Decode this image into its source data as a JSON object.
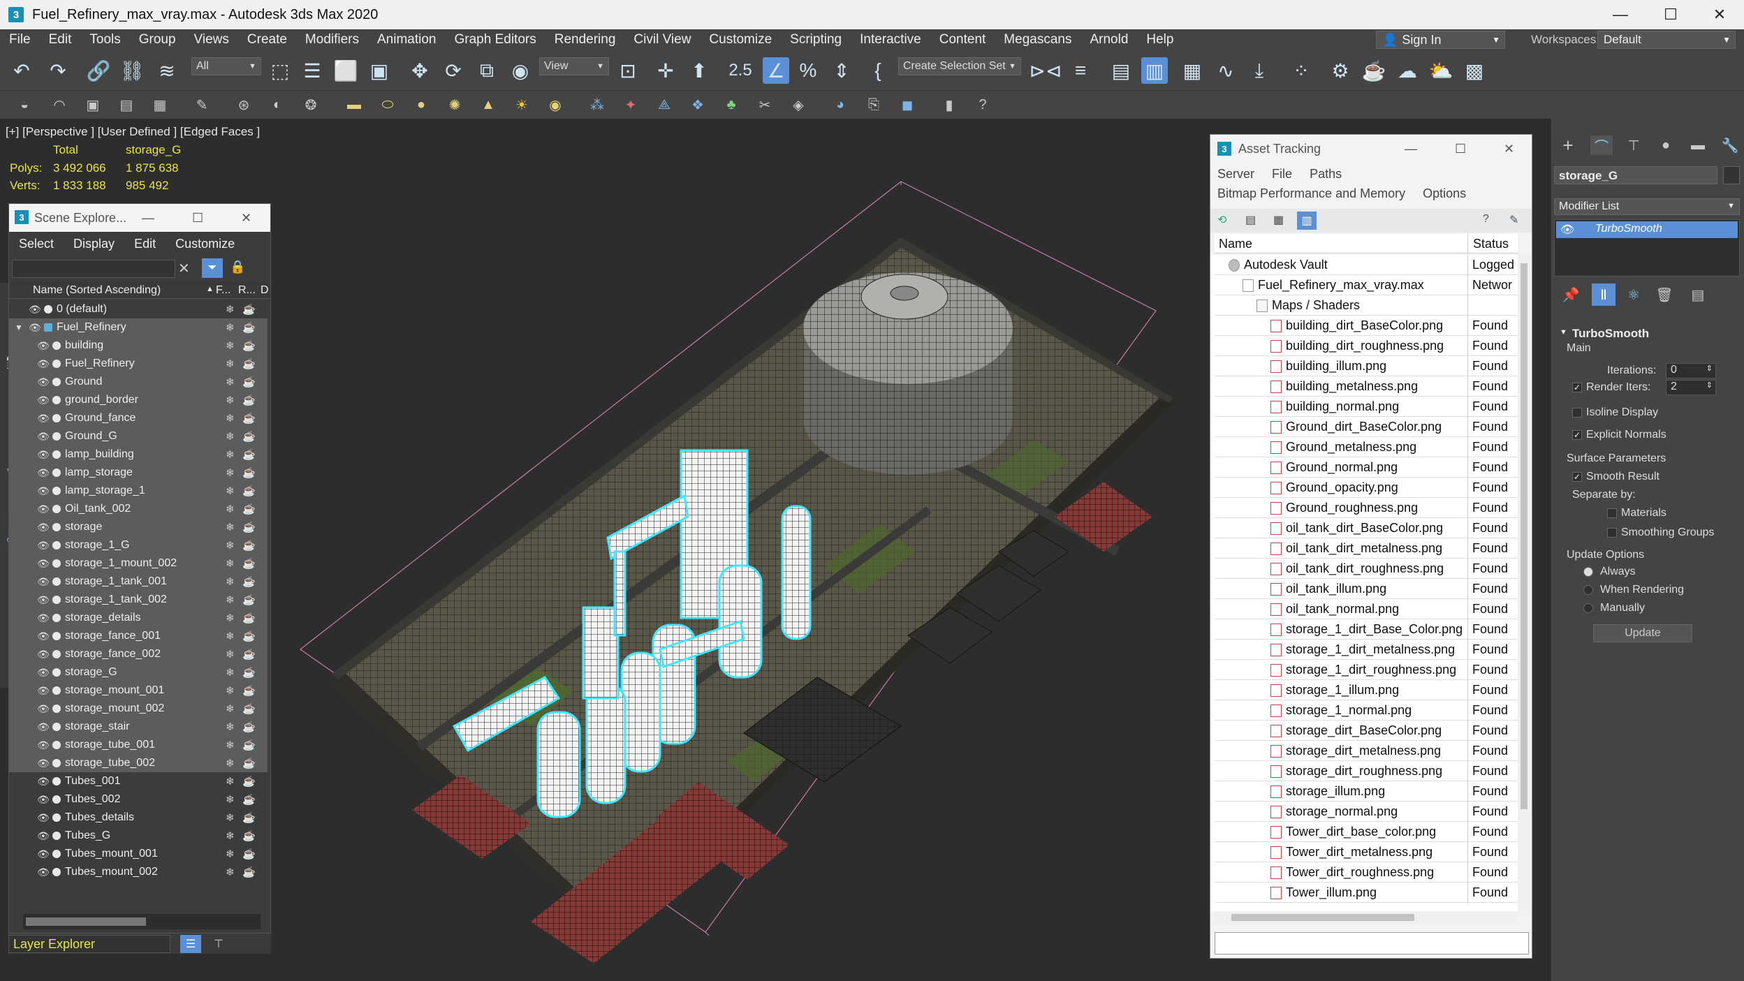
{
  "window": {
    "title": "Fuel_Refinery_max_vray.max - Autodesk 3ds Max 2020",
    "minimize": "—",
    "maximize": "☐",
    "close": "✕"
  },
  "menu": [
    "File",
    "Edit",
    "Tools",
    "Group",
    "Views",
    "Create",
    "Modifiers",
    "Animation",
    "Graph Editors",
    "Rendering",
    "Civil View",
    "Customize",
    "Scripting",
    "Interactive",
    "Content",
    "Megascans",
    "Arnold",
    "Help"
  ],
  "signin": "Sign In",
  "workspaces": {
    "label": "Workspaces:",
    "value": "Default"
  },
  "toolbar": {
    "filter_dropdown": "All",
    "view_dropdown": "View",
    "selection_set": "Create Selection Set",
    "snap_label": "2.5"
  },
  "viewport": {
    "label": "[+] [Perspective ] [User Defined ] [Edged Faces ]",
    "stats": {
      "col_total": "Total",
      "col_object": "storage_G",
      "polys_label": "Polys:",
      "polys_total": "3 492 066",
      "polys_object": "1 875 638",
      "verts_label": "Verts:",
      "verts_total": "1 833 188",
      "verts_object": "985 492"
    }
  },
  "scene_explorer": {
    "title": "Scene Explore...",
    "menu": [
      "Select",
      "Display",
      "Edit",
      "Customize"
    ],
    "columns": {
      "name": "Name (Sorted Ascending)",
      "f": "F...",
      "r": "R...",
      "d": "D"
    },
    "rows": [
      {
        "name": "0 (default)",
        "indent": 1,
        "selected": false
      },
      {
        "name": "Fuel_Refinery",
        "indent": 1,
        "selected": true,
        "expanded": true
      },
      {
        "name": "building",
        "indent": 2,
        "selected": true
      },
      {
        "name": "Fuel_Refinery",
        "indent": 2,
        "selected": true
      },
      {
        "name": "Ground",
        "indent": 2,
        "selected": true
      },
      {
        "name": "ground_border",
        "indent": 2,
        "selected": true
      },
      {
        "name": "Ground_fance",
        "indent": 2,
        "selected": true
      },
      {
        "name": "Ground_G",
        "indent": 2,
        "selected": true
      },
      {
        "name": "lamp_building",
        "indent": 2,
        "selected": true
      },
      {
        "name": "lamp_storage",
        "indent": 2,
        "selected": true
      },
      {
        "name": "lamp_storage_1",
        "indent": 2,
        "selected": true
      },
      {
        "name": "Oil_tank_002",
        "indent": 2,
        "selected": true
      },
      {
        "name": "storage",
        "indent": 2,
        "selected": true
      },
      {
        "name": "storage_1_G",
        "indent": 2,
        "selected": true
      },
      {
        "name": "storage_1_mount_002",
        "indent": 2,
        "selected": true
      },
      {
        "name": "storage_1_tank_001",
        "indent": 2,
        "selected": true
      },
      {
        "name": "storage_1_tank_002",
        "indent": 2,
        "selected": true
      },
      {
        "name": "storage_details",
        "indent": 2,
        "selected": true
      },
      {
        "name": "storage_fance_001",
        "indent": 2,
        "selected": true
      },
      {
        "name": "storage_fance_002",
        "indent": 2,
        "selected": true
      },
      {
        "name": "storage_G",
        "indent": 2,
        "selected": true
      },
      {
        "name": "storage_mount_001",
        "indent": 2,
        "selected": true
      },
      {
        "name": "storage_mount_002",
        "indent": 2,
        "selected": true
      },
      {
        "name": "storage_stair",
        "indent": 2,
        "selected": true
      },
      {
        "name": "storage_tube_001",
        "indent": 2,
        "selected": true
      },
      {
        "name": "storage_tube_002",
        "indent": 2,
        "selected": true
      },
      {
        "name": "Tubes_001",
        "indent": 2,
        "selected": false
      },
      {
        "name": "Tubes_002",
        "indent": 2,
        "selected": false
      },
      {
        "name": "Tubes_details",
        "indent": 2,
        "selected": false
      },
      {
        "name": "Tubes_G",
        "indent": 2,
        "selected": false
      },
      {
        "name": "Tubes_mount_001",
        "indent": 2,
        "selected": false
      },
      {
        "name": "Tubes_mount_002",
        "indent": 2,
        "selected": false
      }
    ],
    "layer_explorer": "Layer Explorer"
  },
  "asset_tracking": {
    "title": "Asset Tracking",
    "menu1": [
      "Server",
      "File",
      "Paths"
    ],
    "menu2": [
      "Bitmap Performance and Memory",
      "Options"
    ],
    "columns": {
      "name": "Name",
      "status": "Status"
    },
    "rows": [
      {
        "name": "Autodesk Vault",
        "status": "Logged",
        "level": 0,
        "kind": "vault"
      },
      {
        "name": "Fuel_Refinery_max_vray.max",
        "status": "Networ",
        "level": 1,
        "kind": "max"
      },
      {
        "name": "Maps / Shaders",
        "status": "",
        "level": 2,
        "kind": "folder"
      },
      {
        "name": "building_dirt_BaseColor.png",
        "status": "Found",
        "level": 3,
        "kind": "img"
      },
      {
        "name": "building_dirt_roughness.png",
        "status": "Found",
        "level": 3,
        "kind": "img"
      },
      {
        "name": "building_illum.png",
        "status": "Found",
        "level": 3,
        "kind": "img"
      },
      {
        "name": "building_metalness.png",
        "status": "Found",
        "level": 3,
        "kind": "img"
      },
      {
        "name": "building_normal.png",
        "status": "Found",
        "level": 3,
        "kind": "img"
      },
      {
        "name": "Ground_dirt_BaseColor.png",
        "status": "Found",
        "level": 3,
        "kind": "img"
      },
      {
        "name": "Ground_metalness.png",
        "status": "Found",
        "level": 3,
        "kind": "img"
      },
      {
        "name": "Ground_normal.png",
        "status": "Found",
        "level": 3,
        "kind": "img"
      },
      {
        "name": "Ground_opacity.png",
        "status": "Found",
        "level": 3,
        "kind": "img"
      },
      {
        "name": "Ground_roughness.png",
        "status": "Found",
        "level": 3,
        "kind": "img"
      },
      {
        "name": "oil_tank_dirt_BaseColor.png",
        "status": "Found",
        "level": 3,
        "kind": "img"
      },
      {
        "name": "oil_tank_dirt_metalness.png",
        "status": "Found",
        "level": 3,
        "kind": "img"
      },
      {
        "name": "oil_tank_dirt_roughness.png",
        "status": "Found",
        "level": 3,
        "kind": "img"
      },
      {
        "name": "oil_tank_illum.png",
        "status": "Found",
        "level": 3,
        "kind": "img"
      },
      {
        "name": "oil_tank_normal.png",
        "status": "Found",
        "level": 3,
        "kind": "img"
      },
      {
        "name": "storage_1_dirt_Base_Color.png",
        "status": "Found",
        "level": 3,
        "kind": "img"
      },
      {
        "name": "storage_1_dirt_metalness.png",
        "status": "Found",
        "level": 3,
        "kind": "img"
      },
      {
        "name": "storage_1_dirt_roughness.png",
        "status": "Found",
        "level": 3,
        "kind": "img"
      },
      {
        "name": "storage_1_illum.png",
        "status": "Found",
        "level": 3,
        "kind": "img"
      },
      {
        "name": "storage_1_normal.png",
        "status": "Found",
        "level": 3,
        "kind": "img"
      },
      {
        "name": "storage_dirt_BaseColor.png",
        "status": "Found",
        "level": 3,
        "kind": "img"
      },
      {
        "name": "storage_dirt_metalness.png",
        "status": "Found",
        "level": 3,
        "kind": "img"
      },
      {
        "name": "storage_dirt_roughness.png",
        "status": "Found",
        "level": 3,
        "kind": "img"
      },
      {
        "name": "storage_illum.png",
        "status": "Found",
        "level": 3,
        "kind": "img"
      },
      {
        "name": "storage_normal.png",
        "status": "Found",
        "level": 3,
        "kind": "img"
      },
      {
        "name": "Tower_dirt_base_color.png",
        "status": "Found",
        "level": 3,
        "kind": "img"
      },
      {
        "name": "Tower_dirt_metalness.png",
        "status": "Found",
        "level": 3,
        "kind": "img"
      },
      {
        "name": "Tower_dirt_roughness.png",
        "status": "Found",
        "level": 3,
        "kind": "img"
      },
      {
        "name": "Tower_illum.png",
        "status": "Found",
        "level": 3,
        "kind": "img"
      }
    ]
  },
  "command_panel": {
    "object_name": "storage_G",
    "modifier_list": "Modifier List",
    "modifier": "TurboSmooth",
    "rollout_title": "TurboSmooth",
    "main": "Main",
    "iterations_label": "Iterations:",
    "iterations_value": "0",
    "render_iters_label": "Render Iters:",
    "render_iters_value": "2",
    "isoline_display": "Isoline Display",
    "explicit_normals": "Explicit Normals",
    "surface_parameters": "Surface Parameters",
    "smooth_result": "Smooth Result",
    "separate_by": "Separate by:",
    "materials": "Materials",
    "smoothing_groups": "Smoothing Groups",
    "update_options": "Update Options",
    "always": "Always",
    "when_rendering": "When Rendering",
    "manually": "Manually",
    "update_button": "Update"
  },
  "colors": {
    "selection_cyan": "#3fe6ff",
    "stats_yellow": "#e8e34a",
    "modifier_blue": "#5b8fd6",
    "ui_dark": "#444444"
  }
}
